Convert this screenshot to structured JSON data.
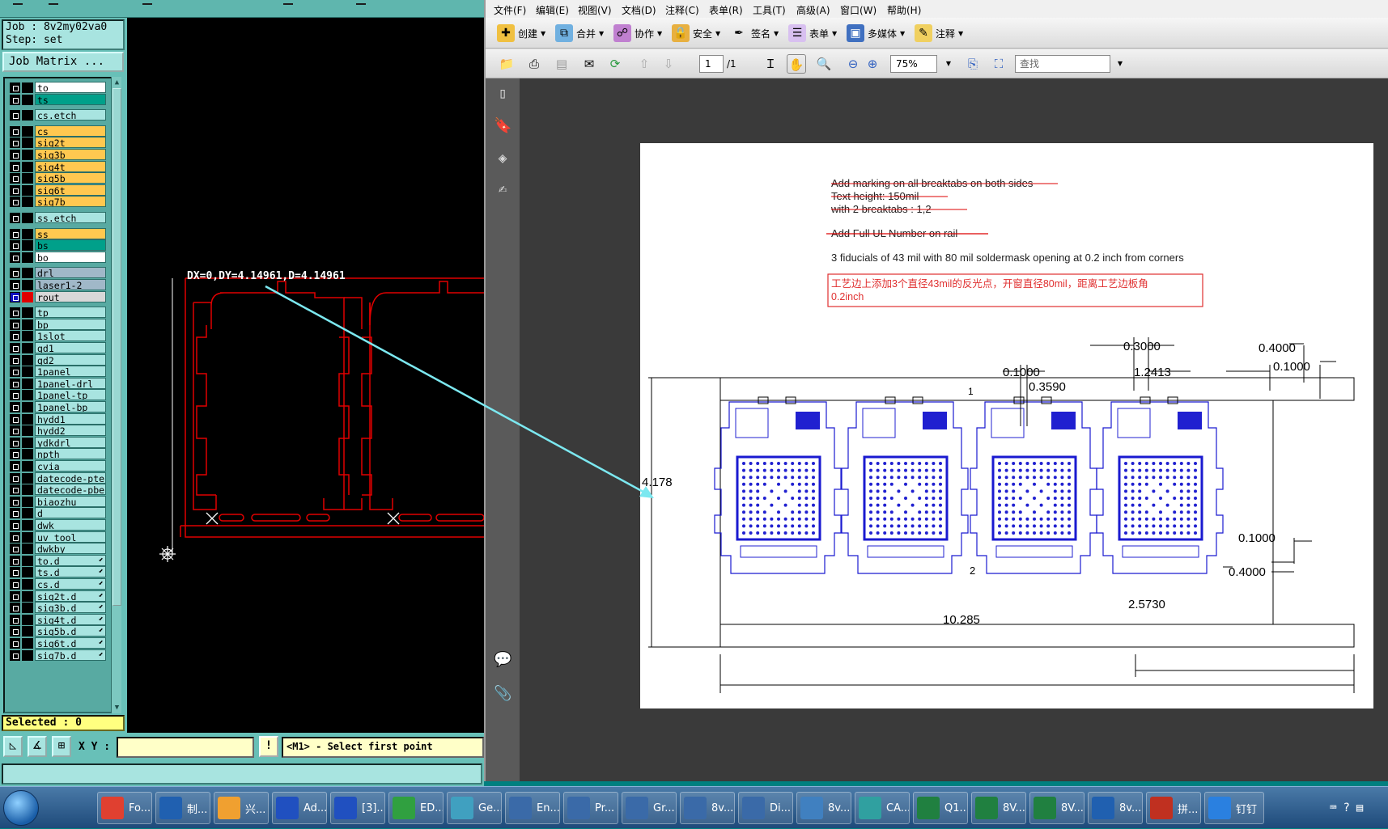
{
  "cam": {
    "job_line": "Job : 8v2my02va0",
    "step_line": "Step: set",
    "job_matrix_button": "Job Matrix ...",
    "layers": [
      {
        "name": "to",
        "color": "#ffffff",
        "gap": false
      },
      {
        "name": "ts",
        "color": "#00a08a",
        "gap": false
      },
      {
        "name": "cs.etch",
        "color": "#a8e4e0",
        "gap": true
      },
      {
        "name": "cs",
        "color": "#ffc850",
        "gap": true
      },
      {
        "name": "sig2t",
        "color": "#ffc850",
        "gap": false
      },
      {
        "name": "sig3b",
        "color": "#ffc850",
        "gap": false
      },
      {
        "name": "sig4t",
        "color": "#ffc850",
        "gap": false
      },
      {
        "name": "sig5b",
        "color": "#ffc850",
        "gap": false
      },
      {
        "name": "sig6t",
        "color": "#ffc850",
        "gap": false
      },
      {
        "name": "sig7b",
        "color": "#ffc850",
        "gap": false
      },
      {
        "name": "ss.etch",
        "color": "#a8e4e0",
        "gap": true
      },
      {
        "name": "ss",
        "color": "#ffc850",
        "gap": true
      },
      {
        "name": "bs",
        "color": "#00a08a",
        "gap": false
      },
      {
        "name": "bo",
        "color": "#ffffff",
        "gap": false
      },
      {
        "name": "drl",
        "color": "#a0b8c8",
        "gap": true
      },
      {
        "name": "laser1-2",
        "color": "#a0b8c8",
        "gap": false
      },
      {
        "name": "rout",
        "color": "#d8d8d8",
        "gap": false,
        "active": true
      },
      {
        "name": "tp",
        "color": "#a8e4e0",
        "gap": true
      },
      {
        "name": "bp",
        "color": "#a8e4e0",
        "gap": false
      },
      {
        "name": "1slot",
        "color": "#a8e4e0",
        "gap": false
      },
      {
        "name": "gd1",
        "color": "#a8e4e0",
        "gap": false
      },
      {
        "name": "gd2",
        "color": "#a8e4e0",
        "gap": false
      },
      {
        "name": "1panel",
        "color": "#a8e4e0",
        "gap": false
      },
      {
        "name": "1panel-drl",
        "color": "#a8e4e0",
        "gap": false
      },
      {
        "name": "1panel-tp",
        "color": "#a8e4e0",
        "gap": false
      },
      {
        "name": "1panel-bp",
        "color": "#a8e4e0",
        "gap": false
      },
      {
        "name": "hydd1",
        "color": "#a8e4e0",
        "gap": false
      },
      {
        "name": "hydd2",
        "color": "#a8e4e0",
        "gap": false
      },
      {
        "name": "ydkdrl",
        "color": "#a8e4e0",
        "gap": false
      },
      {
        "name": "npth",
        "color": "#a8e4e0",
        "gap": false
      },
      {
        "name": "cvia",
        "color": "#a8e4e0",
        "gap": false
      },
      {
        "name": "datecode-pte",
        "color": "#a8e4e0",
        "gap": false
      },
      {
        "name": "datecode-pbe",
        "color": "#a8e4e0",
        "gap": false
      },
      {
        "name": "biaozhu",
        "color": "#a8e4e0",
        "gap": false
      },
      {
        "name": "d",
        "color": "#a8e4e0",
        "gap": false
      },
      {
        "name": "dwk",
        "color": "#a8e4e0",
        "gap": false
      },
      {
        "name": "uv_tool",
        "color": "#a8e4e0",
        "gap": false
      },
      {
        "name": "dwkby",
        "color": "#a8e4e0",
        "gap": false
      },
      {
        "name": "to.d",
        "color": "#a8e4e0",
        "gap": false,
        "icon": true
      },
      {
        "name": "ts.d",
        "color": "#a8e4e0",
        "gap": false,
        "icon": true
      },
      {
        "name": "cs.d",
        "color": "#a8e4e0",
        "gap": false,
        "icon": true
      },
      {
        "name": "sig2t.d",
        "color": "#a8e4e0",
        "gap": false,
        "icon": true
      },
      {
        "name": "sig3b.d",
        "color": "#a8e4e0",
        "gap": false,
        "icon": true
      },
      {
        "name": "sig4t.d",
        "color": "#a8e4e0",
        "gap": false,
        "icon": true
      },
      {
        "name": "sig5b.d",
        "color": "#a8e4e0",
        "gap": false,
        "icon": true
      },
      {
        "name": "sig6t.d",
        "color": "#a8e4e0",
        "gap": false,
        "icon": true
      },
      {
        "name": "sig7b.d",
        "color": "#a8e4e0",
        "gap": false,
        "icon": true
      }
    ],
    "selected": "Selected : 0",
    "measurement": "DX=0,DY=4.14961,D=4.14961",
    "xy_label": "X Y :",
    "xy_value": "",
    "prompt": "<M1> - Select first point",
    "warn_button": "!"
  },
  "pdf": {
    "menu": [
      "文件(F)",
      "编辑(E)",
      "视图(V)",
      "文档(D)",
      "注释(C)",
      "表单(R)",
      "工具(T)",
      "高级(A)",
      "窗口(W)",
      "帮助(H)"
    ],
    "toolbar": [
      "创建",
      "合并",
      "协作",
      "安全",
      "签名",
      "表单",
      "多媒体",
      "注释"
    ],
    "page_current": "1",
    "page_total": "/1",
    "zoom": "75%",
    "find_placeholder": "查找",
    "notes": {
      "line1": "Add marking on all breaktabs on both sides",
      "line2": "Text height: 150mil",
      "line3": "with 2 breaktabs : 1,2",
      "line4": "Add Full UL Number on rail",
      "line5": "3 fiducials of 43 mil with 80 mil soldermask opening at 0.2 inch from corners",
      "cn1": "工艺边上添加3个直径43mil的反光点，开窗直径80mil，距离工艺边板角",
      "cn2": "0.2inch"
    },
    "dims": {
      "d1": "0.3000",
      "d2": "0.4000",
      "d3": "0.1000",
      "d4": "0.1000",
      "d5": "1.2413",
      "d6": "0.3590",
      "d7": "4.178",
      "d8": "0.1000",
      "d9": "0.4000",
      "d10": "2.5730",
      "d11": "10.285",
      "tab1": "1",
      "tab2": "2"
    }
  },
  "taskbar": {
    "items": [
      "Fo...",
      "制...",
      "兴...",
      "Ad...",
      "[3]...",
      "ED...",
      "Ge...",
      "En...",
      "Pr...",
      "Gr...",
      "8v...",
      "Di...",
      "8v...",
      "CA...",
      "Q1...",
      "8V...",
      "8V...",
      "8v...",
      "拼...",
      "钉钉"
    ]
  }
}
